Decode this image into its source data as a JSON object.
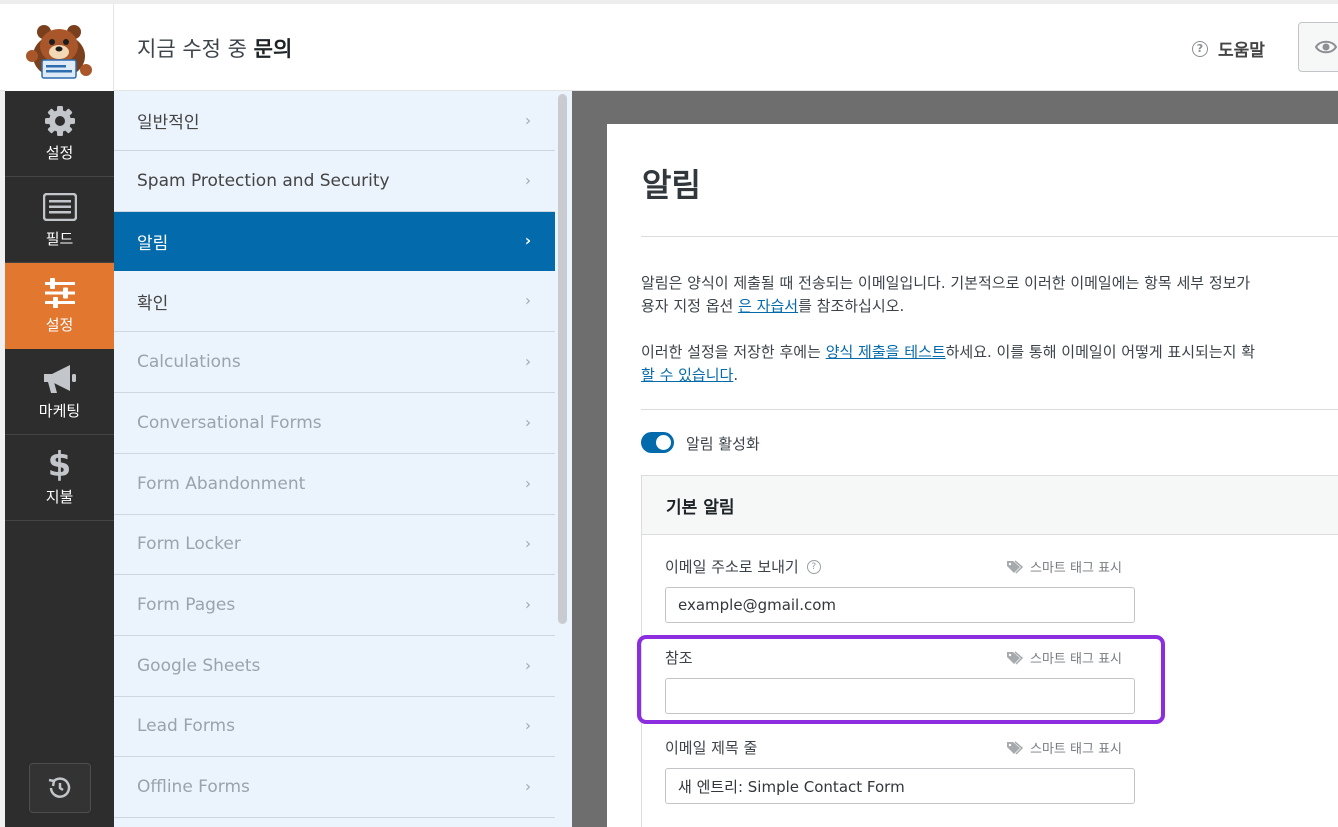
{
  "header": {
    "title_prefix": "지금 수정 중",
    "title_form": "문의",
    "help_label": "도움말"
  },
  "leftnav": {
    "items": [
      {
        "label": "설정",
        "icon": "gear-icon"
      },
      {
        "label": "필드",
        "icon": "fields-list-icon"
      },
      {
        "label": "설정",
        "icon": "sliders-icon",
        "active": true
      },
      {
        "label": "마케팅",
        "icon": "megaphone-icon"
      },
      {
        "label": "지불",
        "icon": "dollar-icon"
      }
    ]
  },
  "panel": {
    "items": [
      {
        "label": "일반적인"
      },
      {
        "label": "Spam Protection and Security"
      },
      {
        "label": "알림",
        "active": true
      },
      {
        "label": "확인"
      },
      {
        "label": "Calculations",
        "muted": true
      },
      {
        "label": "Conversational Forms",
        "muted": true
      },
      {
        "label": "Form Abandonment",
        "muted": true
      },
      {
        "label": "Form Locker",
        "muted": true
      },
      {
        "label": "Form Pages",
        "muted": true
      },
      {
        "label": "Google Sheets",
        "muted": true
      },
      {
        "label": "Lead Forms",
        "muted": true
      },
      {
        "label": "Offline Forms",
        "muted": true
      }
    ]
  },
  "content": {
    "heading": "알림",
    "para1_line1": "알림은 양식이 제출될 때 전송되는 이메일입니다. 기본적으로 이러한 이메일에는 항목 세부 정보가",
    "para1_line2_pre": "용자 지정 옵션 ",
    "para1_link": "은 자습서",
    "para1_line2_post": "를 참조하십시오.",
    "para2_line1_pre": "이러한 설정을 저장한 후에는 ",
    "para2_link1": "양식 제출을 테스트",
    "para2_line1_post": "하세요. 이를 통해 이메일이 어떻게 표시되는지 확",
    "para2_link2": "할 수 있습니다",
    "para2_line2_post": ".",
    "toggle_label": "알림 활성화",
    "section_title": "기본 알림",
    "smart_tag_label": "스마트 태그 표시",
    "fields": {
      "send_to_label": "이메일 주소로 보내기",
      "send_to_value": "example@gmail.com",
      "cc_label": "참조",
      "cc_value": "",
      "subject_label": "이메일 제목 줄",
      "subject_value": "새 엔트리: Simple Contact Form"
    }
  },
  "colors": {
    "accent_orange": "#e27730",
    "accent_blue": "#036aab",
    "highlight_purple": "#8c2ee0"
  }
}
